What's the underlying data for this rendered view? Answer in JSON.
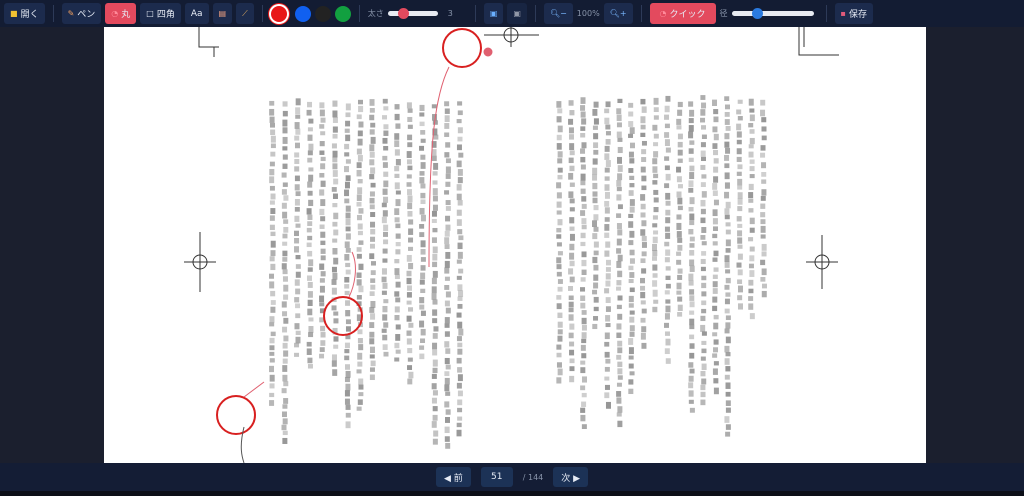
{
  "toolbar": {
    "open": "開く",
    "pen": "ペン",
    "circle": "丸",
    "rect": "四角",
    "text": "Aa",
    "colors": [
      "#e81818",
      "#1060f0",
      "#222222",
      "#12a040"
    ],
    "thickness_label": "太さ",
    "thickness_value": "3",
    "thickness_fraction": 0.2,
    "zoom_level": "100%",
    "quick": "クイック",
    "radius_label": "径",
    "radius_fraction": 0.25,
    "save": "保存"
  },
  "footer": {
    "prev": "◀ 前",
    "page": "51",
    "total": "/ 144",
    "next": "次 ▶"
  }
}
